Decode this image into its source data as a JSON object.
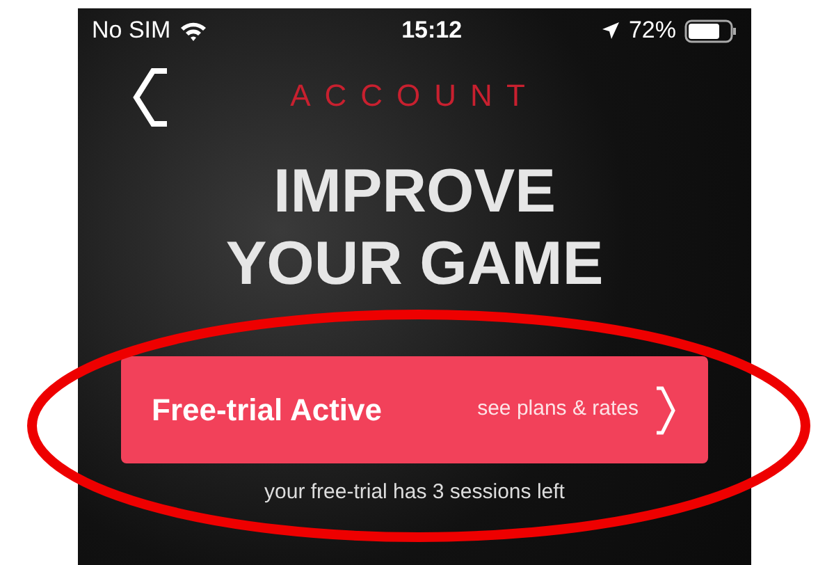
{
  "status_bar": {
    "carrier": "No SIM",
    "time": "15:12",
    "battery": "72%"
  },
  "nav": {
    "title": "ACCOUNT"
  },
  "hero": {
    "lines": [
      "IMPROVE",
      "YOUR GAME"
    ]
  },
  "plan_button": {
    "label": "Free-trial Active",
    "link": "see plans & rates"
  },
  "note": "your free-trial has 3 sessions left"
}
